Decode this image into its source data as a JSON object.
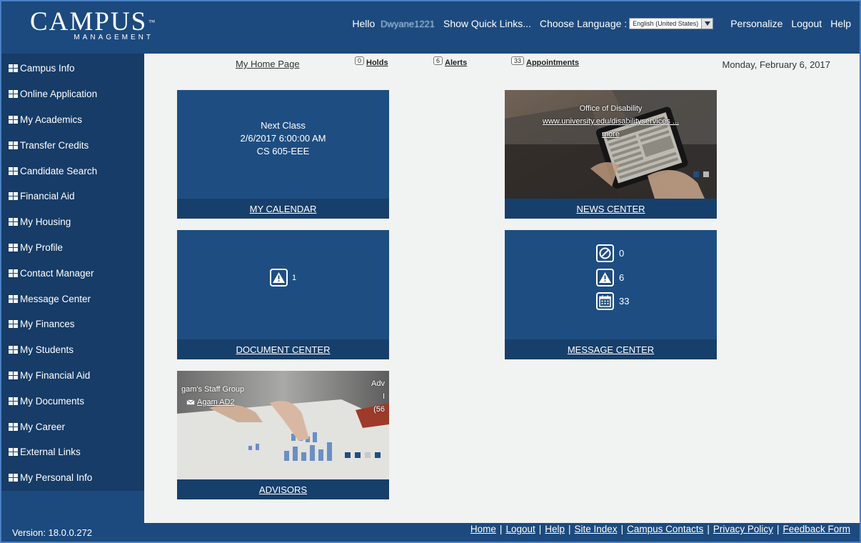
{
  "header": {
    "logo_main": "CAMPUS",
    "logo_tm": "™",
    "logo_sub": "MANAGEMENT",
    "hello_prefix": "Hello",
    "hello_user": "Dwyane1221",
    "quick_links": "Show Quick Links...",
    "language_label": "Choose Language :",
    "language_value": "English (United States)",
    "personalize": "Personalize",
    "logout": "Logout",
    "help": "Help"
  },
  "sidebar": {
    "items": [
      {
        "label": "Campus Info"
      },
      {
        "label": "Online Application"
      },
      {
        "label": "My Academics"
      },
      {
        "label": "Transfer Credits"
      },
      {
        "label": "Candidate Search"
      },
      {
        "label": "Financial Aid"
      },
      {
        "label": "My Housing"
      },
      {
        "label": "My Profile"
      },
      {
        "label": "Contact Manager"
      },
      {
        "label": "Message Center"
      },
      {
        "label": "My Finances"
      },
      {
        "label": "My Students"
      },
      {
        "label": "My Financial Aid"
      },
      {
        "label": "My Documents"
      },
      {
        "label": "My Career"
      },
      {
        "label": "External Links"
      },
      {
        "label": "My Personal Info"
      }
    ]
  },
  "subnav": {
    "home": "My Home Page",
    "holds_count": "0",
    "holds_label": "Holds",
    "alerts_count": "6",
    "alerts_label": "Alerts",
    "appointments_count": "33",
    "appointments_label": "Appointments",
    "date": "Monday, February 6, 2017"
  },
  "tiles": {
    "calendar": {
      "line1": "Next Class",
      "line2": "2/6/2017 6:00:00 AM",
      "line3": "CS 605-EEE",
      "footer": "MY CALENDAR"
    },
    "news": {
      "title": "Office of Disability",
      "url": "www.university.edu/disabilityservices ...",
      "more": "more",
      "footer": "NEWS CENTER"
    },
    "document": {
      "count": "1",
      "footer": "DOCUMENT CENTER"
    },
    "message": {
      "holds": "0",
      "alerts": "6",
      "appointments": "33",
      "footer": "MESSAGE CENTER"
    },
    "advisors": {
      "group": "gam's Staff Group",
      "advisor": "Agam AD2",
      "right_line1": "Adv",
      "right_line2": "I",
      "right_line3": "(56",
      "footer": "ADVISORS"
    }
  },
  "footer": {
    "version": "Version: 18.0.0.272",
    "links": [
      "Home",
      "Logout",
      "Help",
      "Site Index",
      "Campus Contacts",
      "Privacy Policy",
      "Feedback Form"
    ]
  },
  "colors": {
    "brand_blue": "#1c4a7e",
    "tile_blue": "#1e4e81",
    "tile_footer": "#173f6b",
    "sidebar_list": "#163c67",
    "background": "#f1f2f2"
  }
}
